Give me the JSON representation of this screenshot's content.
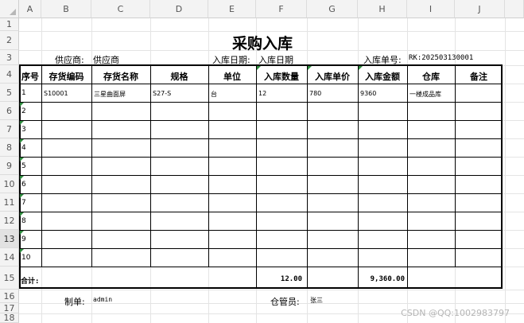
{
  "columns": [
    "A",
    "B",
    "C",
    "D",
    "E",
    "F",
    "G",
    "H",
    "I",
    "J"
  ],
  "rows": [
    "1",
    "2",
    "3",
    "4",
    "5",
    "6",
    "7",
    "8",
    "9",
    "10",
    "11",
    "12",
    "13",
    "14",
    "15",
    "16",
    "17",
    "18"
  ],
  "title": "采购入库",
  "info": {
    "supplier_label": "供应商:",
    "supplier_value": "供应商",
    "date_label": "入库日期:",
    "date_value": "入库日期",
    "order_label": "入库单号:",
    "order_value": "RK:202503130001"
  },
  "headers": [
    "序号",
    "存货编码",
    "存货名称",
    "规格",
    "单位",
    "入库数量",
    "入库单价",
    "入库金额",
    "仓库",
    "备注"
  ],
  "line_items": [
    {
      "no": "1",
      "code": "S10001",
      "name": "三星曲面屏",
      "spec": "S27-S",
      "unit": "台",
      "qty": "12",
      "price": "780",
      "amount": "9360",
      "warehouse": "一楼成品库",
      "remark": ""
    },
    {
      "no": "2"
    },
    {
      "no": "3"
    },
    {
      "no": "4"
    },
    {
      "no": "5"
    },
    {
      "no": "6"
    },
    {
      "no": "7"
    },
    {
      "no": "8"
    },
    {
      "no": "9"
    },
    {
      "no": "10"
    }
  ],
  "totals": {
    "label": "合计:",
    "qty": "12.00",
    "amount": "9,360.00"
  },
  "footer": {
    "maker_label": "制单:",
    "maker_value": "admin",
    "keeper_label": "仓管员:",
    "keeper_value": "张三"
  },
  "watermark": "CSDN @QQ:1002983797",
  "colors": {
    "grid": "#e4e4e4",
    "header_bg": "#f3f3f3",
    "comment_marker": "#2e8b3e"
  }
}
